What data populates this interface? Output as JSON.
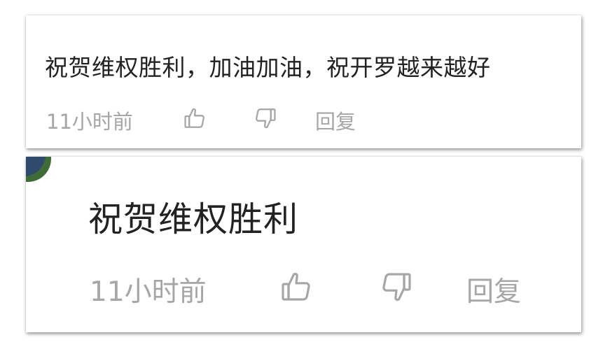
{
  "comments": [
    {
      "text": "祝贺维权胜利，加油加油，祝开罗越来越好",
      "time": "11小时前",
      "reply_label": "回复",
      "like_icon": "thumbs-up-icon",
      "dislike_icon": "thumbs-down-icon"
    },
    {
      "text": "祝贺维权胜利",
      "time": "11小时前",
      "reply_label": "回复",
      "like_icon": "thumbs-up-icon",
      "dislike_icon": "thumbs-down-icon"
    }
  ],
  "colors": {
    "text": "#222222",
    "meta": "#a6a6a6",
    "avatar": "#2f4a6b",
    "avatar_accent": "#3f6b39"
  }
}
